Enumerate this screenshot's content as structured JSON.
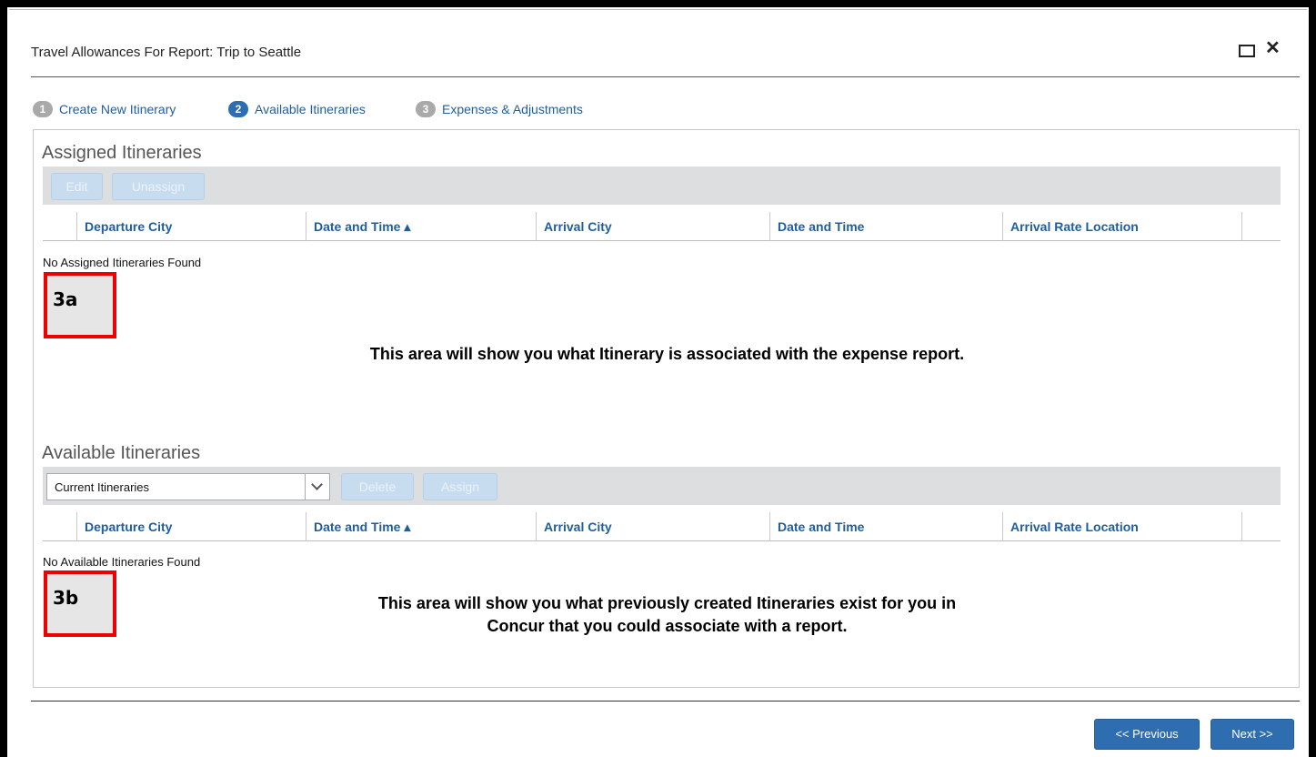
{
  "window": {
    "title": "Travel Allowances For Report: Trip to Seattle",
    "close_symbol": "✕"
  },
  "steps": [
    {
      "number": "1",
      "label": "Create New Itinerary",
      "active": false
    },
    {
      "number": "2",
      "label": "Available Itineraries",
      "active": true
    },
    {
      "number": "3",
      "label": "Expenses & Adjustments",
      "active": false
    }
  ],
  "assigned": {
    "title": "Assigned Itineraries",
    "buttons": {
      "edit": "Edit",
      "unassign": "Unassign"
    },
    "columns": [
      "Departure City",
      "Date and Time ▴",
      "Arrival City",
      "Date and Time",
      "Arrival Rate Location"
    ],
    "empty_message": "No Assigned Itineraries Found",
    "callout": "3a",
    "description": "This area will show you what Itinerary is associated with the expense report."
  },
  "available": {
    "title": "Available Itineraries",
    "filter_value": "Current Itineraries",
    "buttons": {
      "delete": "Delete",
      "assign": "Assign"
    },
    "columns": [
      "Departure City",
      "Date and Time ▴",
      "Arrival City",
      "Date and Time",
      "Arrival Rate Location"
    ],
    "empty_message": "No Available Itineraries Found",
    "callout": "3b",
    "description_line1": "This area will show you what previously created Itineraries exist for you in",
    "description_line2": "Concur that you could associate with a report."
  },
  "footer": {
    "previous": "<< Previous",
    "next": "Next >>"
  },
  "colors": {
    "primary": "#2e6eb0",
    "link": "#1f5e9e",
    "callout_border": "#ee0000",
    "toolbar": "#dcdedf"
  }
}
